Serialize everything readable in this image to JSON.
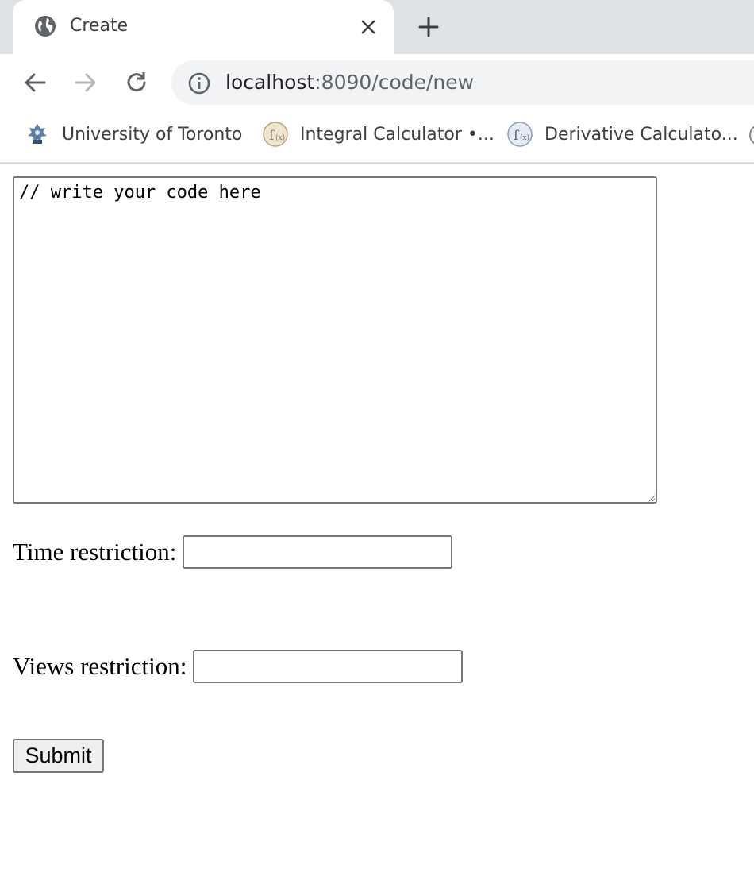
{
  "browser": {
    "tab": {
      "title": "Create"
    },
    "address_bar": {
      "host": "localhost",
      "path": ":8090/code/new"
    },
    "bookmarks": [
      {
        "label": "University of Toronto",
        "icon": "university-crest-icon"
      },
      {
        "label": "Integral Calculator •...",
        "icon": "fx-integral-icon"
      },
      {
        "label": "Derivative Calculato...",
        "icon": "fx-derivative-icon"
      }
    ]
  },
  "form": {
    "code_value": "// write your code here",
    "time_label": "Time restriction:",
    "time_value": "",
    "views_label": "Views restriction:",
    "views_value": "",
    "submit_label": "Submit"
  },
  "colors": {
    "tabstrip_bg": "#dee1e6",
    "omnibox_bg": "#f1f3f4",
    "input_border": "#767676",
    "button_bg": "#efefef"
  }
}
